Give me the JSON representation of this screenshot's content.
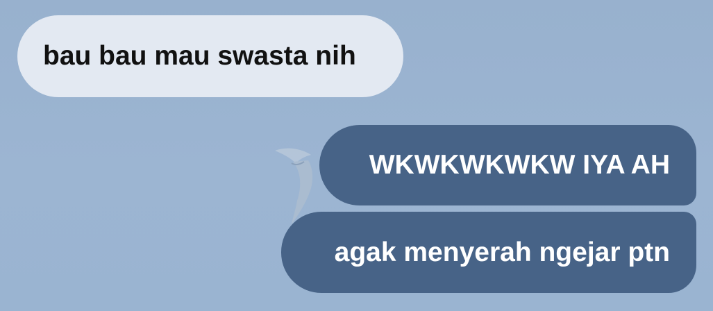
{
  "chat": {
    "messages": [
      {
        "direction": "incoming",
        "text": "bau bau mau swasta nih"
      },
      {
        "direction": "outgoing",
        "text": "WKWKWKWKW IYA AH"
      },
      {
        "direction": "outgoing",
        "text": "agak menyerah ngejar ptn"
      }
    ]
  },
  "colors": {
    "background": "#9ab3d0",
    "incoming_bubble": "#e3e9f2",
    "outgoing_bubble": "#476387",
    "incoming_text": "#111111",
    "outgoing_text": "#ffffff"
  },
  "background_image": {
    "icon": "seagull-wallpaper-icon"
  }
}
